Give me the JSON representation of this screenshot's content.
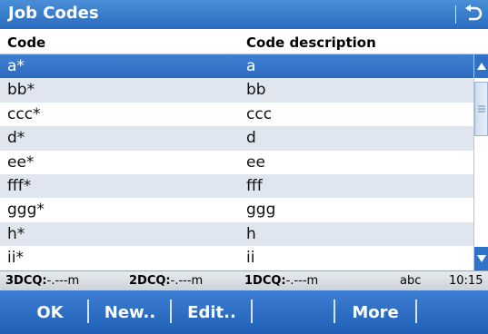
{
  "title": "Job Codes",
  "icons": {
    "back": "back-arrow-icon",
    "scroll_up": "triangle-up-icon",
    "scroll_down": "triangle-down-icon",
    "grip": "grip-lines-icon"
  },
  "colors": {
    "title_bar": "#2a6cc0",
    "selected_row": "#2d6bc0",
    "alt_row": "#dfe6ef",
    "softkey_bar": "#1f5fb6"
  },
  "columns": {
    "code": "Code",
    "description": "Code description"
  },
  "rows": [
    {
      "code": "a*",
      "description": "a"
    },
    {
      "code": "bb*",
      "description": "bb"
    },
    {
      "code": "ccc*",
      "description": "ccc"
    },
    {
      "code": "d*",
      "description": "d"
    },
    {
      "code": "ee*",
      "description": "ee"
    },
    {
      "code": "fff*",
      "description": "fff"
    },
    {
      "code": "ggg*",
      "description": "ggg"
    },
    {
      "code": "h*",
      "description": "h"
    },
    {
      "code": "ii*",
      "description": "ii"
    }
  ],
  "selected_index": 0,
  "status": {
    "dcq3_label": "3DCQ:",
    "dcq3_value": "-.---m",
    "dcq2_label": "2DCQ:",
    "dcq2_value": "-.---m",
    "dcq1_label": "1DCQ:",
    "dcq1_value": "-.---m",
    "input_mode": "abc",
    "time": "10:15"
  },
  "softkeys": {
    "ok": "OK",
    "new": "New..",
    "edit": "Edit..",
    "blank": "",
    "more": "More"
  }
}
